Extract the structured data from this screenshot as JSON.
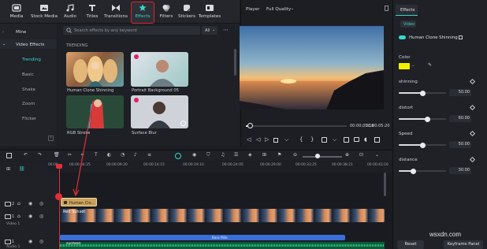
{
  "toolbar": {
    "items": [
      {
        "label": "Media",
        "icon": "media-icon"
      },
      {
        "label": "Stock Media",
        "icon": "stock-media-icon"
      },
      {
        "label": "Audio",
        "icon": "audio-icon"
      },
      {
        "label": "Titles",
        "icon": "titles-icon"
      },
      {
        "label": "Transitions",
        "icon": "transitions-icon"
      },
      {
        "label": "Effects",
        "icon": "effects-icon",
        "active": true
      },
      {
        "label": "Filters",
        "icon": "filters-icon"
      },
      {
        "label": "Stickers",
        "icon": "stickers-icon"
      },
      {
        "label": "Templates",
        "icon": "templates-icon"
      }
    ],
    "accent": "#36d6c9",
    "highlight": "#e0202a"
  },
  "categories": {
    "mine": "Mine",
    "video_effects": "Video Effects",
    "items": [
      "Trending",
      "Basic",
      "Shake",
      "Zoom",
      "Flicker"
    ],
    "selected": "Trending"
  },
  "effects_panel": {
    "search_placeholder": "Search effects by any keyword",
    "filter": "All",
    "section": "TRENDING",
    "effects": [
      {
        "label": "Human Clone Shinning"
      },
      {
        "label": "Portrait Background 05"
      },
      {
        "label": "RGB Stroke"
      },
      {
        "label": "Surface Blur"
      }
    ]
  },
  "player": {
    "label": "Player",
    "quality": "Full Quality",
    "current_time": "00:00:01:16",
    "total_time": "00:00:05:20",
    "progress": 0.04
  },
  "properties": {
    "tab": "Effects",
    "subtab": "Video",
    "effect_name": "Human Clone Shinning",
    "color_label": "Color",
    "color_value": "#f2f200",
    "params": [
      {
        "label": "shinning",
        "value": "50.00",
        "fraction": 0.5
      },
      {
        "label": "distort",
        "value": "60.00",
        "fraction": 0.6
      },
      {
        "label": "Speed",
        "value": "50.00",
        "fraction": 0.5
      },
      {
        "label": "distance",
        "value": "30.00",
        "fraction": 0.3
      }
    ],
    "reset_label": "Reset",
    "keyframe_label": "Keyframe Panel"
  },
  "timeline": {
    "ticks": [
      "00:00",
      "00:00:04:25",
      "00:00:09:20",
      "00:00:14:15",
      "00:00:19:10",
      "00:00:24:05",
      "00:00:29:00",
      "00:00:33:25",
      "00:00:38:21",
      "00:00:43:16"
    ],
    "effect_clip": "Human Clo...",
    "video_clip": "Red Sunset",
    "video_track": "Video 1",
    "bar_label": "Bass Mile",
    "audio_clip": "sunfield",
    "audio_track": "Audio 1",
    "track_numbers": [
      "2",
      "1",
      "1"
    ]
  },
  "watermark": "wsxdn.com"
}
